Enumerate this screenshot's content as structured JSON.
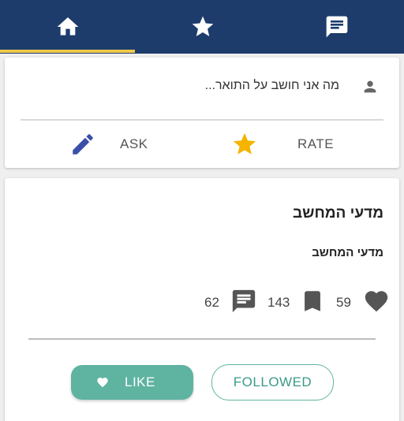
{
  "tabs": [
    {
      "icon": "home-icon",
      "active": true
    },
    {
      "icon": "star-icon",
      "active": false
    },
    {
      "icon": "message-icon",
      "active": false
    }
  ],
  "colors": {
    "header": "#1d3c6c",
    "tab_indicator": "#f2c94c",
    "accent": "#5fb3a1",
    "ask_icon": "#3a4fa8",
    "rate_icon": "#f4b400"
  },
  "compose": {
    "prompt": "מה אני חושב על התואר...",
    "ask_label": "ASK",
    "rate_label": "RATE"
  },
  "post": {
    "title": "מדעי המחשב",
    "subtitle": "מדעי המחשב",
    "likes": "59",
    "bookmarks": "143",
    "comments": "62",
    "like_label": "LIKE",
    "follow_label": "FOLLOWED"
  }
}
